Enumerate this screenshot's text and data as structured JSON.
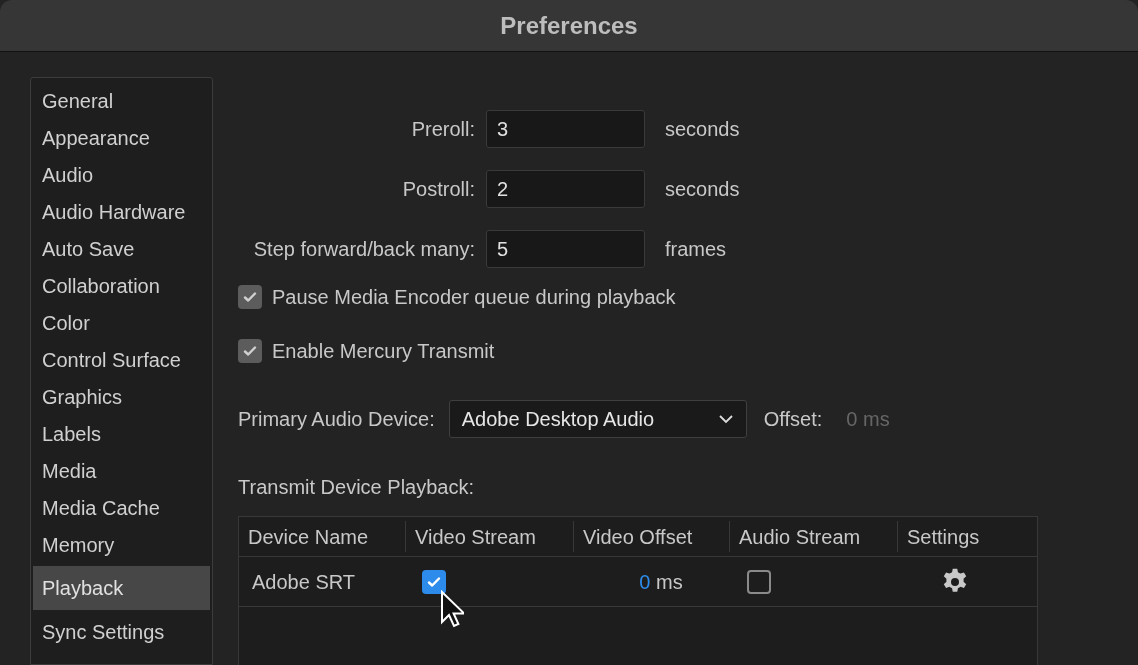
{
  "window": {
    "title": "Preferences"
  },
  "sidebar": {
    "items": [
      {
        "label": "General",
        "selected": false
      },
      {
        "label": "Appearance",
        "selected": false
      },
      {
        "label": "Audio",
        "selected": false
      },
      {
        "label": "Audio Hardware",
        "selected": false
      },
      {
        "label": "Auto Save",
        "selected": false
      },
      {
        "label": "Collaboration",
        "selected": false
      },
      {
        "label": "Color",
        "selected": false
      },
      {
        "label": "Control Surface",
        "selected": false
      },
      {
        "label": "Graphics",
        "selected": false
      },
      {
        "label": "Labels",
        "selected": false
      },
      {
        "label": "Media",
        "selected": false
      },
      {
        "label": "Media Cache",
        "selected": false
      },
      {
        "label": "Memory",
        "selected": false
      },
      {
        "label": "Playback",
        "selected": true
      },
      {
        "label": "Sync Settings",
        "selected": false
      }
    ]
  },
  "fields": [
    {
      "label": "Preroll:",
      "value": "3",
      "unit": "seconds"
    },
    {
      "label": "Postroll:",
      "value": "2",
      "unit": "seconds"
    },
    {
      "label": "Step forward/back many:",
      "value": "5",
      "unit": "frames"
    }
  ],
  "checkboxes": [
    {
      "label": "Pause Media Encoder queue during playback",
      "checked": true
    },
    {
      "label": "Enable Mercury Transmit",
      "checked": true
    }
  ],
  "audio_device": {
    "label": "Primary Audio Device:",
    "value": "Adobe Desktop Audio",
    "offset_label": "Offset:",
    "offset_value": "0 ms"
  },
  "transmit": {
    "label": "Transmit Device Playback:",
    "columns": [
      "Device Name",
      "Video Stream",
      "Video Offset",
      "Audio Stream",
      "Settings"
    ],
    "rows": [
      {
        "device": "Adobe SRT",
        "video_stream": true,
        "offset_value": "0",
        "offset_unit": "ms",
        "audio_stream": false
      }
    ]
  }
}
